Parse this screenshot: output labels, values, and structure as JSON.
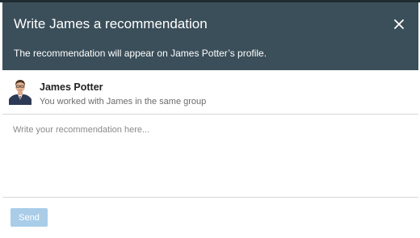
{
  "dialog": {
    "title": "Write James a recommendation",
    "subtitle": "The recommendation will appear on James Potter’s profile.",
    "close_icon": "close-icon"
  },
  "profile": {
    "name": "James Potter",
    "context": "You worked with James in the same group",
    "avatar_icon": "avatar"
  },
  "recommendation": {
    "value": "",
    "placeholder": "Write your recommendation here..."
  },
  "footer": {
    "send_label": "Send",
    "send_enabled": false
  },
  "colors": {
    "header_bg": "#3b4f5a",
    "header_text": "#ffffff",
    "send_disabled_bg": "#a9cde9",
    "divider": "#d9d9d9"
  }
}
